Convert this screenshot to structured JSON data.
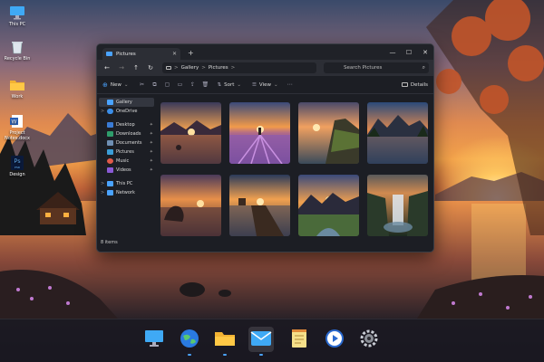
{
  "desktop": {
    "icons": [
      {
        "label": "This PC",
        "icon": "computer-icon"
      },
      {
        "label": "Recycle Bin",
        "icon": "recycle-bin-icon"
      },
      {
        "label": "Work",
        "icon": "folder-icon"
      },
      {
        "label": "Project Notes.docx",
        "icon": "word-document-icon"
      },
      {
        "label": "Design",
        "icon": "photoshop-icon"
      }
    ],
    "photoshop_glyph": "Ps",
    "word_glyph": "W",
    "photoshop_file_glyph": "PSD"
  },
  "window": {
    "tab_title": "Pictures",
    "tab_close": "✕",
    "new_tab": "+",
    "controls": {
      "minimize": "—",
      "maximize": "☐",
      "close": "✕"
    },
    "nav": {
      "back": "←",
      "forward": "→",
      "up": "↑",
      "refresh": "↻"
    },
    "breadcrumb": [
      "Gallery",
      "Pictures"
    ],
    "breadcrumb_sep": ">",
    "search_placeholder": "Search Pictures",
    "toolbar": {
      "new_label": "New",
      "sort_label": "Sort",
      "view_label": "View",
      "details_label": "Details"
    },
    "sidebar": [
      {
        "label": "Gallery",
        "icon": "gallery-icon",
        "selected": true,
        "color": "#4aa3ff"
      },
      {
        "label": "OneDrive",
        "icon": "onedrive-icon",
        "chevron": ">",
        "color": "#3b8ee8"
      },
      {
        "label": "Desktop",
        "icon": "desktop-folder-icon",
        "pin": "📌",
        "color": "#3a7bd5"
      },
      {
        "label": "Downloads",
        "icon": "downloads-icon",
        "pin": "📌",
        "color": "#2e9d6b"
      },
      {
        "label": "Documents",
        "icon": "documents-icon",
        "pin": "📌",
        "color": "#6f8fb3"
      },
      {
        "label": "Pictures",
        "icon": "pictures-icon",
        "pin": "📌",
        "color": "#3b9dd6"
      },
      {
        "label": "Music",
        "icon": "music-icon",
        "pin": "📌",
        "color": "#e05a4a"
      },
      {
        "label": "Videos",
        "icon": "videos-icon",
        "pin": "📌",
        "color": "#8a5ad6"
      },
      {
        "label": "This PC",
        "icon": "this-pc-icon",
        "chevron": ">",
        "color": "#4aa3ff"
      },
      {
        "label": "Network",
        "icon": "network-icon",
        "chevron": ">",
        "color": "#4aa3ff"
      }
    ],
    "status": "8 items"
  },
  "taskbar": {
    "apps": [
      {
        "name": "display-settings-app",
        "icon": "monitor-icon"
      },
      {
        "name": "browser-app",
        "icon": "globe-icon"
      },
      {
        "name": "file-explorer-app",
        "icon": "folder-icon"
      },
      {
        "name": "mail-app",
        "icon": "mail-icon",
        "active": true
      },
      {
        "name": "notes-app",
        "icon": "notepad-icon"
      },
      {
        "name": "media-player-app",
        "icon": "play-icon"
      },
      {
        "name": "settings-app",
        "icon": "gear-icon"
      }
    ]
  },
  "colors": {
    "accent": "#4aa3ff"
  }
}
